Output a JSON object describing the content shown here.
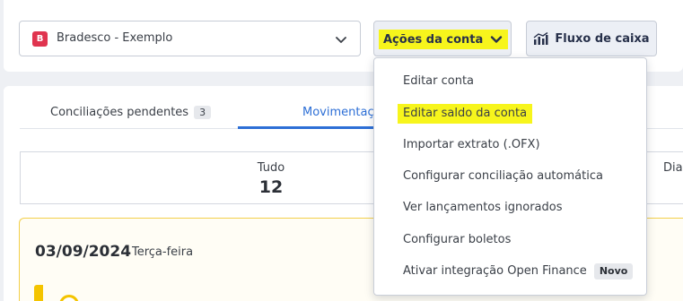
{
  "account_select": {
    "badge": "B",
    "name": "Bradesco - Exemplo",
    "chevron_icon": "chevron-down-icon"
  },
  "toolbar": {
    "actions_label": "Ações da conta",
    "actions_icon": "chevron-down-icon",
    "cashflow_label": "Fluxo de caixa",
    "cashflow_icon": "bar-chart-icon"
  },
  "tabs": [
    {
      "label": "Conciliações pendentes",
      "count": "3"
    },
    {
      "label": "Movimentaç"
    }
  ],
  "summary": {
    "items": [
      {
        "label": "Tudo",
        "value": "12"
      },
      {
        "label": "Dias"
      }
    ]
  },
  "day_group": {
    "date": "03/09/2024",
    "weekday": "Terça-feira"
  },
  "menu": {
    "items": [
      {
        "label": "Editar conta"
      },
      {
        "label": "Editar saldo da conta"
      },
      {
        "label": "Importar extrato (.OFX)"
      },
      {
        "label": "Configurar conciliação automática"
      },
      {
        "label": "Ver lançamentos ignorados"
      },
      {
        "label": "Configurar boletos"
      },
      {
        "label": "Ativar integração Open Finance",
        "badge": "Novo"
      }
    ]
  },
  "colors": {
    "highlight": "#f7f51c",
    "accent": "#2d6fd6",
    "bank_brand": "#e0344f",
    "warning": "#f4c400"
  }
}
